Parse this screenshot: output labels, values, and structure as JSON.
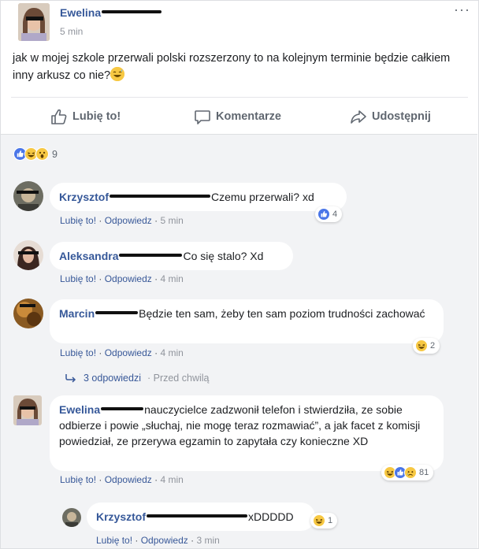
{
  "post": {
    "author": "Ewelina",
    "time": "5 min",
    "more": "···",
    "text": "jak w mojej szkole przerwali polski rozszerzony to na kolejnym terminie będzie całkiem inny arkusz co nie?"
  },
  "actions": {
    "like": "Lubię to!",
    "comment": "Komentarze",
    "share": "Udostępnij"
  },
  "reactions_summary": {
    "count": "9",
    "icons": [
      "like",
      "haha",
      "wow"
    ]
  },
  "comments": [
    {
      "author": "Krzysztof",
      "text": "Czemu przerwali? xd",
      "like": "Lubię to!",
      "reply": "Odpowiedz",
      "time": "5 min",
      "reaction_count": "4",
      "reaction_icons": [
        "like"
      ]
    },
    {
      "author": "Aleksandra",
      "text": "Co się stalo? Xd",
      "like": "Lubię to!",
      "reply": "Odpowiedz",
      "time": "4 min"
    },
    {
      "author": "Marcin",
      "text": "Będzie ten sam, żeby ten sam poziom trudności zachować",
      "like": "Lubię to!",
      "reply": "Odpowiedz",
      "time": "4 min",
      "reaction_count": "2",
      "reaction_icons": [
        "haha"
      ],
      "replies_label": "3 odpowiedzi",
      "replies_time": "Przed chwilą"
    },
    {
      "author": "Ewelina",
      "text": "nauczycielce zadzwonił telefon i stwierdziła, ze sobie odbierze i powie „słuchaj, nie mogę teraz rozmawiać”, a jak facet z komisji powiedział, ze przerywa egzamin to zapytała czy konieczne XD",
      "like": "Lubię to!",
      "reply": "Odpowiedz",
      "time": "4 min",
      "reaction_count": "81",
      "reaction_icons": [
        "haha",
        "like",
        "sad"
      ]
    }
  ],
  "reply": {
    "author": "Krzysztof",
    "text": "xDDDDD",
    "like": "Lubię to!",
    "reply": "Odpowiedz",
    "time": "3 min",
    "reaction_count": "1",
    "reaction_icons": [
      "haha"
    ]
  },
  "colors": {
    "link": "#365899",
    "meta": "#90949c",
    "bubble": "#ffffff",
    "comments_bg": "#f2f3f5",
    "like_blue": "#4a76e8",
    "emoji_yellow": "#f7c843"
  }
}
